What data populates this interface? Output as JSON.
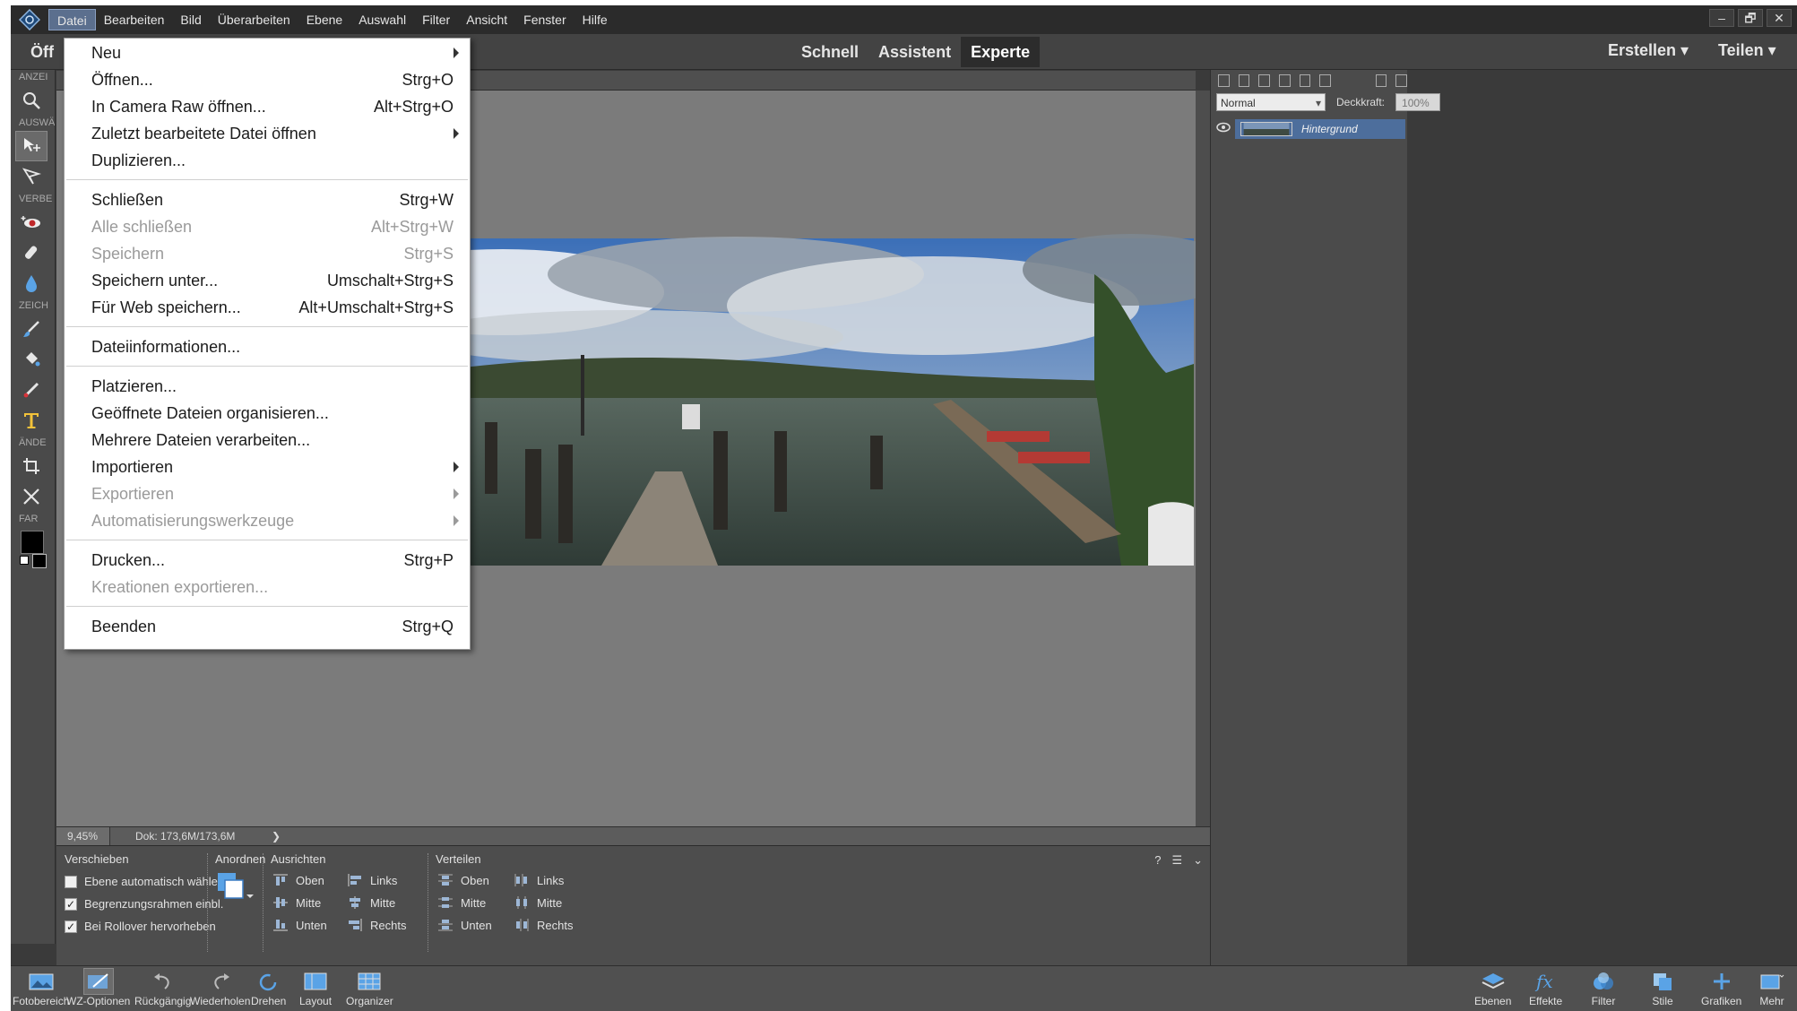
{
  "menubar": {
    "items": [
      "Datei",
      "Bearbeiten",
      "Bild",
      "Überarbeiten",
      "Ebene",
      "Auswahl",
      "Filter",
      "Ansicht",
      "Fenster",
      "Hilfe"
    ],
    "window_controls": [
      "–",
      "🗗",
      "✕"
    ]
  },
  "modebar": {
    "open_label": "Öff",
    "tabs": [
      "Schnell",
      "Assistent",
      "Experte"
    ],
    "active_tab": "Experte",
    "create_label": "Erstellen ▾",
    "share_label": "Teilen ▾"
  },
  "toolbox": {
    "sections": {
      "view": "ANZEI",
      "select": "AUSWÄ",
      "enhance": "VERBE",
      "draw": "ZEICH",
      "modify": "ÄNDE",
      "color": "FAR"
    },
    "tools": [
      "zoom-icon",
      "move-icon",
      "lasso-icon",
      "red-eye-icon",
      "healing-brush-icon",
      "blur-icon",
      "brush-icon",
      "paint-bucket-icon",
      "eyedropper-icon",
      "text-icon",
      "crop-icon",
      "recompose-icon"
    ],
    "foreground_color": "#000000",
    "background_color": "#000000"
  },
  "status": {
    "zoom": "9,45%",
    "doc_size": "Dok: 173,6M/173,6M",
    "arrow": "❯"
  },
  "options": {
    "move_title": "Verschieben",
    "arrange_title": "Anordnen",
    "align_title": "Ausrichten",
    "distribute_title": "Verteilen",
    "checkboxes": [
      {
        "label": "Ebene automatisch wählen",
        "checked": false
      },
      {
        "label": "Begrenzungsrahmen einbl.",
        "checked": true
      },
      {
        "label": "Bei Rollover hervorheben",
        "checked": true
      }
    ],
    "align": {
      "col1": [
        "Oben",
        "Mitte",
        "Unten"
      ],
      "col2": [
        "Links",
        "Mitte",
        "Rechts"
      ]
    },
    "distribute": {
      "col1": [
        "Oben",
        "Mitte",
        "Unten"
      ],
      "col2": [
        "Links",
        "Mitte",
        "Rechts"
      ]
    },
    "help": "?",
    "menu": "☰",
    "collapse": "⌄"
  },
  "layers": {
    "blend_mode": "Normal",
    "opacity_label": "Deckkraft:",
    "opacity_value": "100%",
    "layer_name": "Hintergrund"
  },
  "taskbar": {
    "left": [
      "Fotobereich",
      "WZ-Optionen",
      "Rückgängig",
      "Wiederholen",
      "Drehen",
      "Layout",
      "Organizer"
    ],
    "right": [
      "Ebenen",
      "Effekte",
      "Filter",
      "Stile",
      "Grafiken",
      "Mehr"
    ]
  },
  "file_menu": {
    "items": [
      {
        "label": "Neu",
        "shortcut": "",
        "submenu": true,
        "disabled": false
      },
      {
        "label": "Öffnen...",
        "shortcut": "Strg+O",
        "submenu": false,
        "disabled": false
      },
      {
        "label": "In Camera Raw öffnen...",
        "shortcut": "Alt+Strg+O",
        "submenu": false,
        "disabled": false
      },
      {
        "label": "Zuletzt bearbeitete Datei öffnen",
        "shortcut": "",
        "submenu": true,
        "disabled": false
      },
      {
        "label": "Duplizieren...",
        "shortcut": "",
        "submenu": false,
        "disabled": false
      },
      {
        "label": "Schließen",
        "shortcut": "Strg+W",
        "submenu": false,
        "disabled": false
      },
      {
        "label": "Alle schließen",
        "shortcut": "Alt+Strg+W",
        "submenu": false,
        "disabled": true
      },
      {
        "label": "Speichern",
        "shortcut": "Strg+S",
        "submenu": false,
        "disabled": true
      },
      {
        "label": "Speichern unter...",
        "shortcut": "Umschalt+Strg+S",
        "submenu": false,
        "disabled": false
      },
      {
        "label": "Für Web speichern...",
        "shortcut": "Alt+Umschalt+Strg+S",
        "submenu": false,
        "disabled": false
      },
      {
        "label": "Dateiinformationen...",
        "shortcut": "",
        "submenu": false,
        "disabled": false
      },
      {
        "label": "Platzieren...",
        "shortcut": "",
        "submenu": false,
        "disabled": false
      },
      {
        "label": "Geöffnete Dateien organisieren...",
        "shortcut": "",
        "submenu": false,
        "disabled": false
      },
      {
        "label": "Mehrere Dateien verarbeiten...",
        "shortcut": "",
        "submenu": false,
        "disabled": false
      },
      {
        "label": "Importieren",
        "shortcut": "",
        "submenu": true,
        "disabled": false
      },
      {
        "label": "Exportieren",
        "shortcut": "",
        "submenu": true,
        "disabled": true
      },
      {
        "label": "Automatisierungswerkzeuge",
        "shortcut": "",
        "submenu": true,
        "disabled": true
      },
      {
        "label": "Drucken...",
        "shortcut": "Strg+P",
        "submenu": false,
        "disabled": false
      },
      {
        "label": "Kreationen exportieren...",
        "shortcut": "",
        "submenu": false,
        "disabled": true
      },
      {
        "label": "Beenden",
        "shortcut": "Strg+Q",
        "submenu": false,
        "disabled": false
      }
    ]
  },
  "colors": {
    "accent": "#5b6f8e",
    "layer_selected": "#4d6e9c",
    "canvas": "#7b7b7b"
  }
}
